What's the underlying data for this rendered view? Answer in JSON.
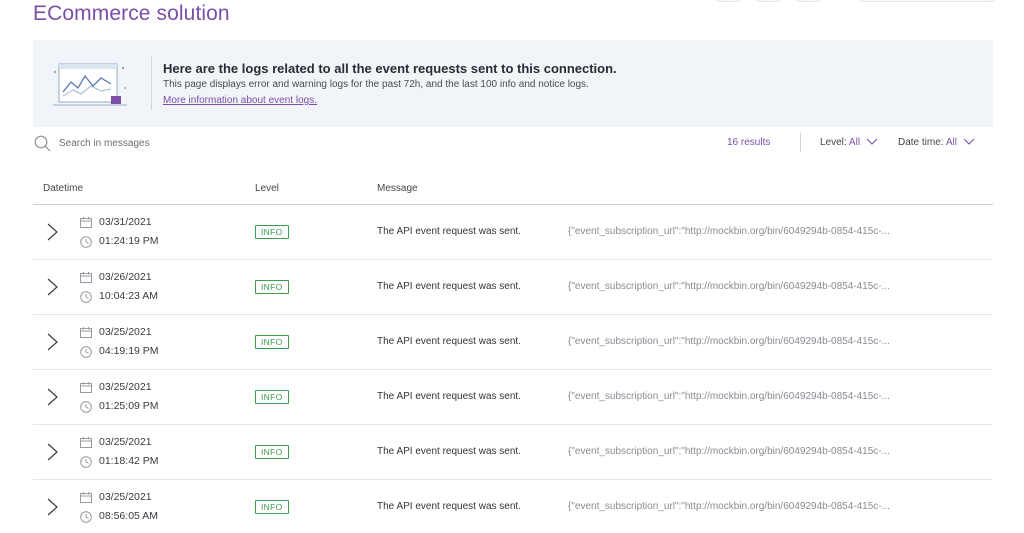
{
  "page": {
    "title": "ECommerce solution"
  },
  "banner": {
    "heading": "Here are the logs related to all the event requests sent to this connection.",
    "description": "This page displays error and warning logs for the past 72h, and the last 100 info and notice logs.",
    "link": "More information about event logs."
  },
  "toolbar": {
    "search_placeholder": "Search in messages",
    "results": "16 results",
    "level_label": "Level:",
    "level_value": "All",
    "datetime_label": "Date time:",
    "datetime_value": "All"
  },
  "table": {
    "headers": {
      "datetime": "Datetime",
      "level": "Level",
      "message": "Message"
    },
    "rows": [
      {
        "date": "03/31/2021",
        "time": "01:24:19 PM",
        "level": "INFO",
        "message": "The API event request was sent.",
        "payload": "{\"event_subscription_url\":\"http://mockbin.org/bin/6049294b-0854-415c-..."
      },
      {
        "date": "03/26/2021",
        "time": "10:04:23 AM",
        "level": "INFO",
        "message": "The API event request was sent.",
        "payload": "{\"event_subscription_url\":\"http://mockbin.org/bin/6049294b-0854-415c-..."
      },
      {
        "date": "03/25/2021",
        "time": "04:19:19 PM",
        "level": "INFO",
        "message": "The API event request was sent.",
        "payload": "{\"event_subscription_url\":\"http://mockbin.org/bin/6049294b-0854-415c-..."
      },
      {
        "date": "03/25/2021",
        "time": "01:25:09 PM",
        "level": "INFO",
        "message": "The API event request was sent.",
        "payload": "{\"event_subscription_url\":\"http://mockbin.org/bin/6049294b-0854-415c-..."
      },
      {
        "date": "03/25/2021",
        "time": "01:18:42 PM",
        "level": "INFO",
        "message": "The API event request was sent.",
        "payload": "{\"event_subscription_url\":\"http://mockbin.org/bin/6049294b-0854-415c-..."
      },
      {
        "date": "03/25/2021",
        "time": "08:56:05 AM",
        "level": "INFO",
        "message": "The API event request was sent.",
        "payload": "{\"event_subscription_url\":\"http://mockbin.org/bin/6049294b-0854-415c-..."
      }
    ]
  },
  "colors": {
    "accent": "#7b4fa8",
    "info": "#3d9b4e",
    "banner_bg": "#f1f5f9"
  },
  "icons": [
    "search-icon",
    "chevron-down-icon",
    "chevron-right-icon",
    "calendar-icon",
    "clock-icon",
    "banner-illustration"
  ]
}
